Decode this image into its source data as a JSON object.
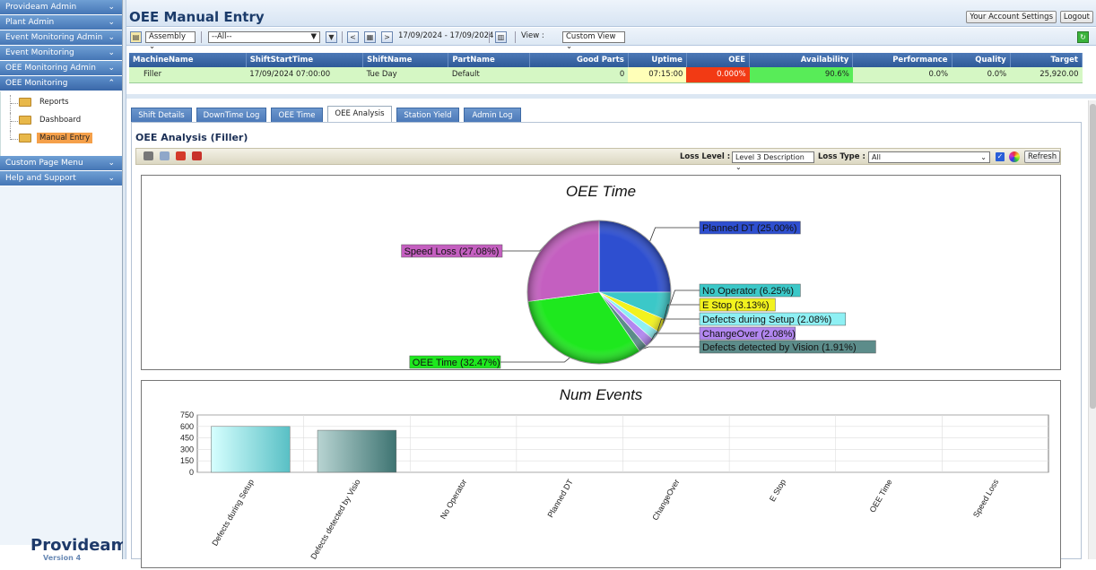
{
  "sidebar": {
    "menus": [
      "Provideam Admin",
      "Plant Admin",
      "Event Monitoring Admin",
      "Event Monitoring",
      "OEE Monitoring Admin",
      "OEE Monitoring"
    ],
    "items": [
      "Reports",
      "Dashboard",
      "Manual Entry"
    ],
    "menus_after": [
      "Custom Page Menu",
      "Help and Support"
    ],
    "logo": "Provideam",
    "version": "Version 4"
  },
  "header": {
    "title": "OEE Manual Entry",
    "account_settings": "Your Account Settings",
    "logout": "Logout"
  },
  "toolbar": {
    "assembly": "Assembly",
    "filter": "--All--",
    "date_range": "17/09/2024 - 17/09/2024",
    "view_label": "View :",
    "view_value": "Custom View"
  },
  "grid": {
    "columns": [
      "MachineName",
      "ShiftStartTime",
      "ShiftName",
      "PartName",
      "Good Parts",
      "Uptime",
      "OEE",
      "Availability",
      "Performance",
      "Quality",
      "Target"
    ],
    "row": [
      "Filler",
      "17/09/2024 07:00:00",
      "Tue Day",
      "Default",
      "0",
      "07:15:00",
      "0.000%",
      "90.6%",
      "0.0%",
      "0.0%",
      "25,920.00"
    ]
  },
  "tabs": [
    "Shift Details",
    "DownTime Log",
    "OEE Time",
    "OEE Analysis",
    "Station Yield",
    "Admin Log"
  ],
  "analysis": {
    "title": "OEE Analysis (Filler)",
    "loss_level_label": "Loss Level :",
    "loss_level_value": "Level 3 Description",
    "loss_type_label": "Loss Type :",
    "loss_type_value": "All",
    "refresh": "Refresh"
  },
  "chart_data": [
    {
      "type": "pie",
      "title": "OEE Time",
      "slices": [
        {
          "label": "Planned DT (25.00%)",
          "value": 25.0,
          "color": "#2e4fd0"
        },
        {
          "label": "No Operator (6.25%)",
          "value": 6.25,
          "color": "#3bc8c8"
        },
        {
          "label": "E Stop (3.13%)",
          "value": 3.13,
          "color": "#f2f21e"
        },
        {
          "label": "Defects during Setup (2.08%)",
          "value": 2.08,
          "color": "#8ef0f4"
        },
        {
          "label": "ChangeOver (2.08%)",
          "value": 2.08,
          "color": "#b287f0"
        },
        {
          "label": "Defects detected by Vision (1.91%)",
          "value": 1.91,
          "color": "#5c8c8a"
        },
        {
          "label": "OEE Time (32.47%)",
          "value": 32.47,
          "color": "#1ee81e"
        },
        {
          "label": "Speed Loss (27.08%)",
          "value": 27.08,
          "color": "#c45fc0"
        }
      ]
    },
    {
      "type": "bar",
      "title": "Num Events",
      "categories": [
        "Defects during Setup",
        "Defects detected by Visio",
        "No Operator",
        "Planned DT",
        "ChangeOver",
        "E Stop",
        "OEE Time",
        "Speed Loss"
      ],
      "values": [
        600,
        550,
        0,
        0,
        0,
        0,
        0,
        0
      ],
      "yticks": [
        "750",
        "600",
        "450",
        "300",
        "150",
        "0"
      ],
      "ylim": [
        0,
        750
      ]
    }
  ]
}
